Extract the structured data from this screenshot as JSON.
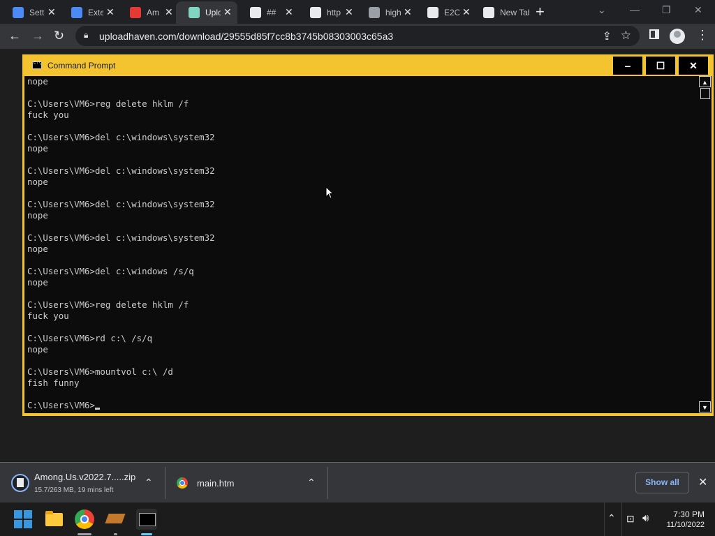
{
  "browser": {
    "tabs": [
      {
        "title": "Setti",
        "icon": "gear-icon",
        "color": "#4c8bf5",
        "active": false
      },
      {
        "title": "Exte",
        "icon": "puzzle-icon",
        "color": "#4c8bf5",
        "active": false
      },
      {
        "title": "Am",
        "icon": "among-us-icon",
        "color": "#e53935",
        "active": false
      },
      {
        "title": "Uplo",
        "icon": "cloud-icon",
        "color": "#7fd6c2",
        "active": true
      },
      {
        "title": "##",
        "icon": "globe-icon",
        "color": "#e8eaed",
        "active": false
      },
      {
        "title": "http",
        "icon": "globe-icon",
        "color": "#e8eaed",
        "active": false
      },
      {
        "title": "high",
        "icon": "globe-icon",
        "color": "#9aa0a6",
        "active": false
      },
      {
        "title": "E2C",
        "icon": "grid-icon",
        "color": "#e8eaed",
        "active": false
      },
      {
        "title": "New Tab",
        "icon": "chrome-icon",
        "color": "#e8eaed",
        "active": false
      }
    ],
    "new_tab_symbol": "+",
    "close_symbol": "✕",
    "url": "uploadhaven.com/download/29555d85f7cc8b3745b08303003c65a3"
  },
  "cmd": {
    "title": "Command Prompt",
    "minimize": "‒",
    "maximize": "☐",
    "close": "✕",
    "lines": [
      "nope",
      "",
      "C:\\Users\\VM6>reg delete hklm /f",
      "fuck you",
      "",
      "C:\\Users\\VM6>del c:\\windows\\system32",
      "nope",
      "",
      "C:\\Users\\VM6>del c:\\windows\\system32",
      "nope",
      "",
      "C:\\Users\\VM6>del c:\\windows\\system32",
      "nope",
      "",
      "C:\\Users\\VM6>del c:\\windows\\system32",
      "nope",
      "",
      "C:\\Users\\VM6>del c:\\windows /s/q",
      "nope",
      "",
      "C:\\Users\\VM6>reg delete hklm /f",
      "fuck you",
      "",
      "C:\\Users\\VM6>rd c:\\ /s/q",
      "nope",
      "",
      "C:\\Users\\VM6>mountvol c:\\ /d",
      "fish funny",
      ""
    ],
    "prompt": "C:\\Users\\VM6>",
    "title_bar_color": "#f4c430"
  },
  "downloads": {
    "item1": {
      "name": "Among.Us.v2022.7.....zip",
      "status": "15.7/263 MB, 19 mins left"
    },
    "item2": {
      "name": "main.htm"
    },
    "show_all": "Show all",
    "close": "✕",
    "chevron": "⌃"
  },
  "taskbar": {
    "time": "7:30 PM",
    "date": "11/10/2022",
    "tray_chevron": "⌃"
  }
}
